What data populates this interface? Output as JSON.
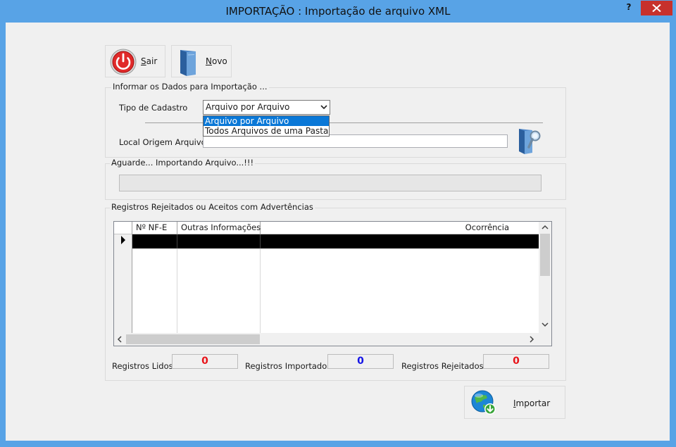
{
  "window": {
    "title": "IMPORTAÇÃO : Importação de arquivo XML",
    "help": "?",
    "close_icon": "close-icon"
  },
  "toolbar": {
    "sair_accel": "S",
    "sair_rest": "air",
    "novo_accel": "N",
    "novo_rest": "ovo"
  },
  "import_group": {
    "title": "Informar os Dados para Importação ...",
    "tipo_label": "Tipo de Cadastro",
    "tipo_value": "Arquivo por Arquivo",
    "tipo_options": [
      "Arquivo por Arquivo",
      "Todos Arquivos de uma Pasta"
    ],
    "local_label": "Local Origem Arquivo",
    "local_value": ""
  },
  "progress_group": {
    "title": "Aguarde... Importando Arquivo...!!!",
    "progress": 0
  },
  "log_group": {
    "title": "Registros Rejeitados ou Aceitos com Advertências",
    "columns": [
      "Nº NF-E",
      "Outras Informações",
      "Ocorrência"
    ],
    "rows": [
      [
        "",
        "",
        ""
      ]
    ]
  },
  "counters": {
    "lidos_label": "Registros Lidos",
    "lidos_value": "0",
    "importados_label": "Registros Importados",
    "importados_value": "0",
    "rejeitados_label": "Registros Rejeitados",
    "rejeitados_value": "0"
  },
  "importar": {
    "accel": "I",
    "rest": "mportar"
  },
  "colors": {
    "frame": "#58a3e6",
    "close": "#c7312c",
    "selection": "#0a78d7",
    "count_red": "#e8141a",
    "count_blue": "#1414e6"
  }
}
